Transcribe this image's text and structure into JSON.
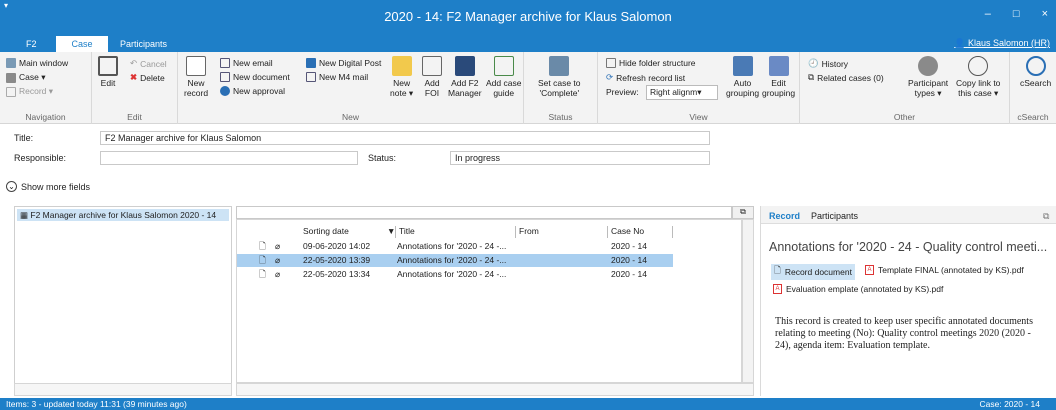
{
  "window": {
    "title": "2020 - 14: F2 Manager archive for Klaus Salomon",
    "quick_access": "▾",
    "minimize": "–",
    "maximize": "□",
    "close": "×"
  },
  "tabs": [
    {
      "label": "F2"
    },
    {
      "label": "Case"
    },
    {
      "label": "Participants"
    }
  ],
  "user": "Klaus Salomon (HR)",
  "ribbon": {
    "navigation": {
      "label": "Navigation",
      "main_window": "Main window",
      "case": "Case ▾",
      "record": "Record ▾"
    },
    "edit": {
      "label": "Edit",
      "edit": "Edit",
      "cancel": "Cancel",
      "delete": "Delete"
    },
    "new": {
      "label": "New",
      "new_record_1": "New",
      "new_record_2": "record",
      "new_email": "New email",
      "new_document": "New document",
      "new_approval": "New approval",
      "new_digital_post": "New Digital Post",
      "new_m4_mail": "New M4 mail",
      "new_note_1": "New",
      "new_note_2": "note ▾",
      "add_foi_1": "Add",
      "add_foi_2": "FOI",
      "add_f2_1": "Add F2",
      "add_f2_2": "Manager",
      "add_guide_1": "Add case",
      "add_guide_2": "guide"
    },
    "status": {
      "label": "Status",
      "set_1": "Set case to",
      "set_2": "'Complete'"
    },
    "view": {
      "label": "View",
      "hide_folder": "Hide folder structure",
      "refresh": "Refresh record list",
      "preview_label": "Preview:",
      "preview_value": "Right alignm▾",
      "auto_1": "Auto",
      "auto_2": "grouping",
      "edit_g_1": "Edit",
      "edit_g_2": "grouping"
    },
    "other": {
      "label": "Other",
      "history": "History",
      "related": "Related cases (0)",
      "participant_1": "Participant",
      "participant_2": "types ▾",
      "copy_1": "Copy link to",
      "copy_2": "this case ▾"
    },
    "csearch": {
      "label": "cSearch",
      "button": "cSearch"
    }
  },
  "fields": {
    "title_label": "Title:",
    "title_value": "F2 Manager archive for Klaus Salomon",
    "responsible_label": "Responsible:",
    "responsible_value": "",
    "status_label": "Status:",
    "status_value": "In progress",
    "show_more": "Show more fields"
  },
  "tree": {
    "item": "F2 Manager archive for Klaus Salomon 2020 - 14"
  },
  "records": {
    "search_placeholder": "",
    "columns": {
      "sorting_date": "Sorting date",
      "title": "Title",
      "from": "From",
      "case_no": "Case No"
    },
    "rows": [
      {
        "date": "09-06-2020 14:02",
        "title": "Annotations for '2020 - 24 -...",
        "from": "",
        "case_no": "2020 - 14",
        "selected": false
      },
      {
        "date": "22-05-2020 13:39",
        "title": "Annotations for '2020 - 24 -...",
        "from": "",
        "case_no": "2020 - 14",
        "selected": true
      },
      {
        "date": "22-05-2020 13:34",
        "title": "Annotations for '2020 - 24 -...",
        "from": "",
        "case_no": "2020 - 14",
        "selected": false
      }
    ]
  },
  "preview": {
    "tab_record": "Record",
    "tab_participants": "Participants",
    "heading": "Annotations for '2020 - 24 - Quality control meeti...",
    "record_document": "Record document",
    "attachment_1": "Template FINAL (annotated by KS).pdf",
    "attachment_2": "Evaluation emplate (annotated by KS).pdf",
    "description": "This record is created to keep user specific annotated documents relating to meeting (No): Quality control meetings 2020 (2020 - 24), agenda item: Evaluation template."
  },
  "status_bar": {
    "left": "Items: 3 - updated today 11:31 (39 minutes ago)",
    "right": "Case: 2020 - 14"
  },
  "colors": {
    "accent": "#1e7fc8",
    "selected_row": "#a9cff0"
  }
}
